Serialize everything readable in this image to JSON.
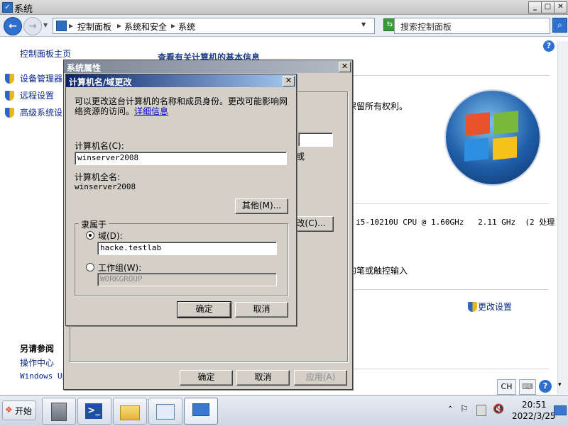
{
  "window": {
    "title": "系统",
    "min": "_",
    "max": "□",
    "close": "✕"
  },
  "address": {
    "crumbs": [
      "控制面板",
      "系统和安全",
      "系统"
    ],
    "sep": "▸",
    "search_placeholder": "搜索控制面板"
  },
  "left_nav": {
    "home": "控制面板主页",
    "items": [
      "设备管理器",
      "远程设置",
      "高级系统设"
    ],
    "see_also_title": "另请参阅",
    "see_also": [
      "操作中心",
      "Windows Up"
    ]
  },
  "main": {
    "heading": "查看有关计算机的基本信息",
    "rights_text": "保留所有权利。",
    "processor_text": "i5-10210U CPU @ 1.60GHz   2.11 GHz  (2 处理",
    "pen_text": "的笔或触控输入",
    "change_settings": "更改设置",
    "bg_partial": "或"
  },
  "sys_props": {
    "title": "系统属性",
    "change_btn": "改(C)...",
    "ok": "确定",
    "cancel": "取消",
    "apply": "应用(A)"
  },
  "name_dialog": {
    "title": "计算机名/域更改",
    "desc": "可以更改这台计算机的名称和成员身份。更改可能影响网络资源的访问。",
    "more_info": "详细信息",
    "name_label": "计算机名(C):",
    "name_value": "winserver2008",
    "full_name_label": "计算机全名:",
    "full_name_value": "winserver2008",
    "other_btn": "其他(M)...",
    "member_of": "隶属于",
    "domain_label": "域(D):",
    "domain_value": "hacke.testlab",
    "workgroup_label": "工作组(W):",
    "workgroup_value": "WORKGROUP",
    "ok": "确定",
    "cancel": "取消"
  },
  "taskbar": {
    "start": "开始",
    "lang": "CH",
    "time": "20:51",
    "date": "2022/3/25"
  },
  "colors": {
    "dialog_bg": "#d4d0c8",
    "title_active": "#0a246a",
    "link": "#0a2a8a"
  }
}
